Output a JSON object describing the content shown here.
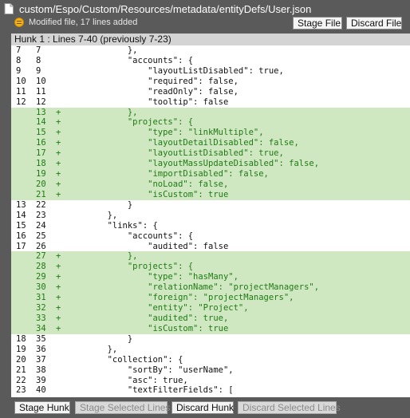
{
  "file": {
    "path": "custom/Espo/Custom/Resources/metadata/entityDefs/User.json",
    "status": "Modified file, 17 lines added"
  },
  "header_buttons": {
    "stage_file": "Stage File",
    "discard_file": "Discard File"
  },
  "hunk": {
    "title": "Hunk 1 : Lines 7-40 (previously 7-23)"
  },
  "lines": [
    {
      "old": "7",
      "new": "7",
      "marker": "",
      "code": "            },",
      "added": false
    },
    {
      "old": "8",
      "new": "8",
      "marker": "",
      "code": "            \"accounts\": {",
      "added": false
    },
    {
      "old": "9",
      "new": "9",
      "marker": "",
      "code": "                \"layoutListDisabled\": true,",
      "added": false
    },
    {
      "old": "10",
      "new": "10",
      "marker": "",
      "code": "                \"required\": false,",
      "added": false
    },
    {
      "old": "11",
      "new": "11",
      "marker": "",
      "code": "                \"readOnly\": false,",
      "added": false
    },
    {
      "old": "12",
      "new": "12",
      "marker": "",
      "code": "                \"tooltip\": false",
      "added": false
    },
    {
      "old": "",
      "new": "13",
      "marker": "+",
      "code": "            },",
      "added": true
    },
    {
      "old": "",
      "new": "14",
      "marker": "+",
      "code": "            \"projects\": {",
      "added": true
    },
    {
      "old": "",
      "new": "15",
      "marker": "+",
      "code": "                \"type\": \"linkMultiple\",",
      "added": true
    },
    {
      "old": "",
      "new": "16",
      "marker": "+",
      "code": "                \"layoutDetailDisabled\": false,",
      "added": true
    },
    {
      "old": "",
      "new": "17",
      "marker": "+",
      "code": "                \"layoutListDisabled\": true,",
      "added": true
    },
    {
      "old": "",
      "new": "18",
      "marker": "+",
      "code": "                \"layoutMassUpdateDisabled\": false,",
      "added": true
    },
    {
      "old": "",
      "new": "19",
      "marker": "+",
      "code": "                \"importDisabled\": false,",
      "added": true
    },
    {
      "old": "",
      "new": "20",
      "marker": "+",
      "code": "                \"noLoad\": false,",
      "added": true
    },
    {
      "old": "",
      "new": "21",
      "marker": "+",
      "code": "                \"isCustom\": true",
      "added": true
    },
    {
      "old": "13",
      "new": "22",
      "marker": "",
      "code": "            }",
      "added": false
    },
    {
      "old": "14",
      "new": "23",
      "marker": "",
      "code": "        },",
      "added": false
    },
    {
      "old": "15",
      "new": "24",
      "marker": "",
      "code": "        \"links\": {",
      "added": false
    },
    {
      "old": "16",
      "new": "25",
      "marker": "",
      "code": "            \"accounts\": {",
      "added": false
    },
    {
      "old": "17",
      "new": "26",
      "marker": "",
      "code": "                \"audited\": false",
      "added": false
    },
    {
      "old": "",
      "new": "27",
      "marker": "+",
      "code": "            },",
      "added": true
    },
    {
      "old": "",
      "new": "28",
      "marker": "+",
      "code": "            \"projects\": {",
      "added": true
    },
    {
      "old": "",
      "new": "29",
      "marker": "+",
      "code": "                \"type\": \"hasMany\",",
      "added": true
    },
    {
      "old": "",
      "new": "30",
      "marker": "+",
      "code": "                \"relationName\": \"projectManagers\",",
      "added": true
    },
    {
      "old": "",
      "new": "31",
      "marker": "+",
      "code": "                \"foreign\": \"projectManagers\",",
      "added": true
    },
    {
      "old": "",
      "new": "32",
      "marker": "+",
      "code": "                \"entity\": \"Project\",",
      "added": true
    },
    {
      "old": "",
      "new": "33",
      "marker": "+",
      "code": "                \"audited\": true,",
      "added": true
    },
    {
      "old": "",
      "new": "34",
      "marker": "+",
      "code": "                \"isCustom\": true",
      "added": true
    },
    {
      "old": "18",
      "new": "35",
      "marker": "",
      "code": "            }",
      "added": false
    },
    {
      "old": "19",
      "new": "36",
      "marker": "",
      "code": "        },",
      "added": false
    },
    {
      "old": "20",
      "new": "37",
      "marker": "",
      "code": "        \"collection\": {",
      "added": false
    },
    {
      "old": "21",
      "new": "38",
      "marker": "",
      "code": "            \"sortBy\": \"userName\",",
      "added": false
    },
    {
      "old": "22",
      "new": "39",
      "marker": "",
      "code": "            \"asc\": true,",
      "added": false
    },
    {
      "old": "23",
      "new": "40",
      "marker": "",
      "code": "            \"textFilterFields\": [",
      "added": false
    }
  ],
  "footer_buttons": {
    "stage_hunk": "Stage Hunk",
    "stage_selected_lines": "Stage Selected Lines",
    "discard_hunk": "Discard Hunk",
    "discard_selected_lines": "Discard Selected Lines"
  },
  "icons": {
    "file": "file-icon",
    "modified": "modified-status-icon"
  },
  "colors": {
    "background": "#5a5a5a",
    "added_line_bg": "#d0e8c2",
    "added_line_text": "#1f7a14"
  }
}
